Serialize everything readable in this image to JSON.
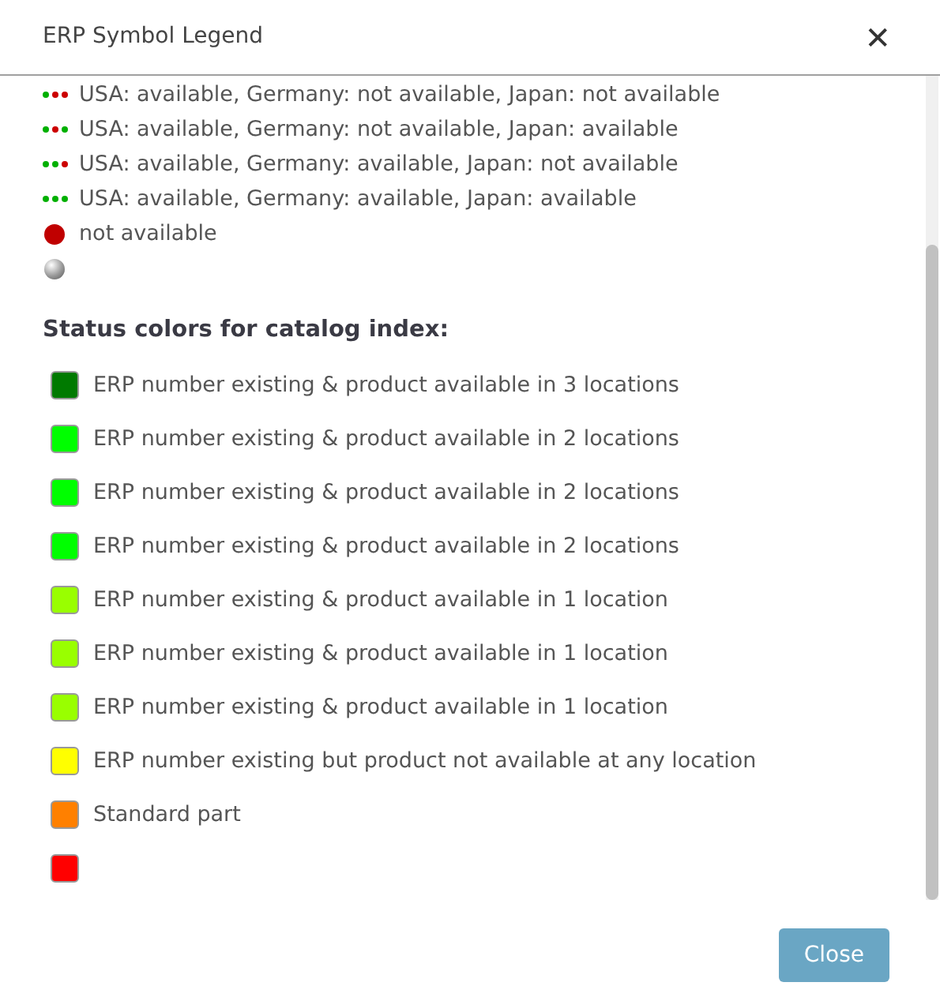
{
  "dialog": {
    "title": "ERP Symbol Legend",
    "close_glyph": "✕"
  },
  "symbols": [
    {
      "kind": "dots",
      "dots": [
        {
          "color": "#00b000"
        },
        {
          "color": "#cc0000"
        },
        {
          "color": "#cc0000"
        }
      ],
      "label": "USA: available, Germany: not available, Japan: not available"
    },
    {
      "kind": "dots",
      "dots": [
        {
          "color": "#00b000"
        },
        {
          "color": "#cc0000"
        },
        {
          "color": "#00b000"
        }
      ],
      "label": "USA: available, Germany: not available, Japan: available"
    },
    {
      "kind": "dots",
      "dots": [
        {
          "color": "#00b000"
        },
        {
          "color": "#00b000"
        },
        {
          "color": "#cc0000"
        }
      ],
      "label": "USA: available, Germany: available, Japan: not available"
    },
    {
      "kind": "dots",
      "dots": [
        {
          "color": "#00b000"
        },
        {
          "color": "#00b000"
        },
        {
          "color": "#00b000"
        }
      ],
      "label": "USA: available, Germany: available, Japan: available"
    },
    {
      "kind": "dot",
      "color": "#c00000",
      "label": "not available"
    },
    {
      "kind": "sphere"
    }
  ],
  "status_heading": "Status colors for catalog index:",
  "status_colors": [
    {
      "color": "#007a00",
      "label": "ERP number existing & product available in 3 locations"
    },
    {
      "color": "#00ff00",
      "label": "ERP number existing & product available in 2 locations"
    },
    {
      "color": "#00ff00",
      "label": "ERP number existing & product available in 2 locations"
    },
    {
      "color": "#00ff00",
      "label": "ERP number existing & product available in 2 locations"
    },
    {
      "color": "#99ff00",
      "label": "ERP number existing & product available in 1 location"
    },
    {
      "color": "#99ff00",
      "label": "ERP number existing & product available in 1 location"
    },
    {
      "color": "#99ff00",
      "label": "ERP number existing & product available in 1 location"
    },
    {
      "color": "#ffff00",
      "label": "ERP number existing but product not available at any location"
    },
    {
      "color": "#ff8000",
      "label": "Standard part"
    },
    {
      "color": "#ff0000"
    }
  ],
  "buttons": [
    {
      "label": "Close"
    }
  ]
}
